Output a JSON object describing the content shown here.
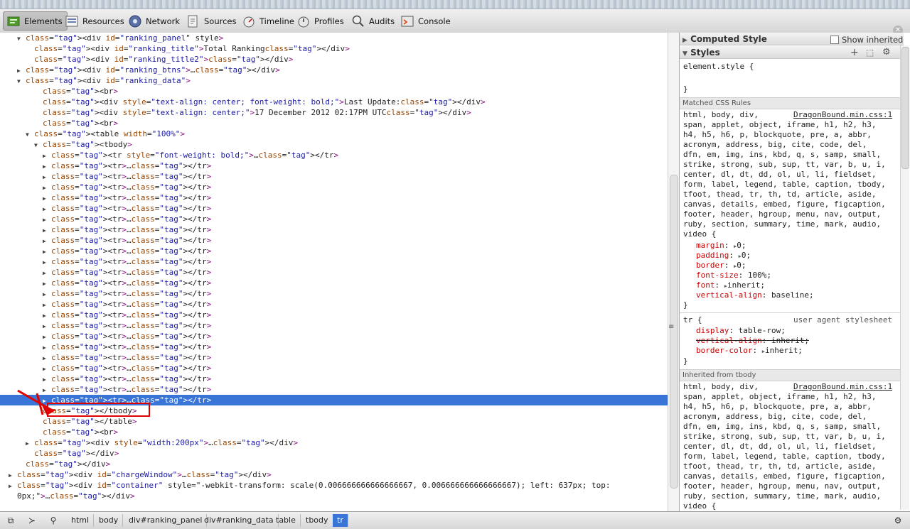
{
  "toolbar": {
    "tabs": [
      {
        "label": "Elements",
        "icon": "elements-icon"
      },
      {
        "label": "Resources",
        "icon": "resources-icon"
      },
      {
        "label": "Network",
        "icon": "network-icon"
      },
      {
        "label": "Sources",
        "icon": "sources-icon"
      },
      {
        "label": "Timeline",
        "icon": "timeline-icon"
      },
      {
        "label": "Profiles",
        "icon": "profiles-icon"
      },
      {
        "label": "Audits",
        "icon": "audits-icon"
      },
      {
        "label": "Console",
        "icon": "console-icon"
      }
    ],
    "active_tab": "Elements"
  },
  "dom_tree": {
    "lines": [
      {
        "tri": "▼",
        "text": "<div id=\"ranking_panel\" style>"
      },
      {
        "tri": "",
        "text": "<div id=\"ranking_title\">Total Ranking</div>"
      },
      {
        "tri": "",
        "text": "<div id=\"ranking_title2\"></div>"
      },
      {
        "tri": "▶",
        "text": "<div id=\"ranking_btns\">…</div>"
      },
      {
        "tri": "▼",
        "text": "<div id=\"ranking_data\">"
      },
      {
        "tri": "",
        "text": "<br>"
      },
      {
        "tri": "",
        "text": "<div style=\"text-align: center; font-weight: bold;\">Last Update:</div>"
      },
      {
        "tri": "",
        "text": "<div style=\"text-align: center;\">17 December 2012 02:17PM UTC</div>"
      },
      {
        "tri": "",
        "text": "<br>"
      },
      {
        "tri": "▼",
        "text": "<table width=\"100%\">"
      },
      {
        "tri": "▼",
        "text": "<tbody>"
      },
      {
        "tri": "▶",
        "text": "<tr style=\"font-weight: bold;\">…</tr>"
      },
      {
        "tri": "▶",
        "text": "<tr>…</tr>"
      },
      {
        "tri": "▶",
        "text": "<tr>…</tr>"
      },
      {
        "tri": "▶",
        "text": "<tr>…</tr>"
      },
      {
        "tri": "▶",
        "text": "<tr>…</tr>"
      },
      {
        "tri": "▶",
        "text": "<tr>…</tr>"
      },
      {
        "tri": "▶",
        "text": "<tr>…</tr>"
      },
      {
        "tri": "▶",
        "text": "<tr>…</tr>"
      },
      {
        "tri": "▶",
        "text": "<tr>…</tr>"
      },
      {
        "tri": "▶",
        "text": "<tr>…</tr>"
      },
      {
        "tri": "▶",
        "text": "<tr>…</tr>"
      },
      {
        "tri": "▶",
        "text": "<tr>…</tr>"
      },
      {
        "tri": "▶",
        "text": "<tr>…</tr>"
      },
      {
        "tri": "▶",
        "text": "<tr>…</tr>"
      },
      {
        "tri": "▶",
        "text": "<tr>…</tr>"
      },
      {
        "tri": "▶",
        "text": "<tr>…</tr>"
      },
      {
        "tri": "▶",
        "text": "<tr>…</tr>"
      },
      {
        "tri": "▶",
        "text": "<tr>…</tr>"
      },
      {
        "tri": "▶",
        "text": "<tr>…</tr>"
      },
      {
        "tri": "▶",
        "text": "<tr>…</tr>"
      },
      {
        "tri": "▶",
        "text": "<tr>…</tr>"
      },
      {
        "tri": "▶",
        "text": "<tr>…</tr>"
      },
      {
        "tri": "▶",
        "text": "<tr>…</tr>"
      },
      {
        "tri": "▶",
        "text": "<tr>…</tr>",
        "selected": true
      },
      {
        "tri": "",
        "text": "</tbody>"
      },
      {
        "tri": "",
        "text": "</table>"
      },
      {
        "tri": "",
        "text": "<br>"
      },
      {
        "tri": "▶",
        "text": "<div style=\"width:200px\">…</div>"
      },
      {
        "tri": "",
        "text": "</div>"
      },
      {
        "tri": "",
        "text": "</div>"
      },
      {
        "tri": "▶",
        "text": "<div id=\"chargeWindow\">…</div>"
      },
      {
        "tri": "▶",
        "text": "<div id=\"container\" style=\"-webkit-transform: scale(0.006666666666666667, 0.006666666666666667); left: 637px; top:"
      },
      {
        "tri": "",
        "text": "0px;\">…</div>"
      }
    ]
  },
  "sidebar": {
    "computed_style": {
      "title": "Computed Style",
      "show_inherited": "Show inherited"
    },
    "styles": {
      "title": "Styles"
    },
    "element_style": {
      "selector": "element.style {",
      "close": "}"
    },
    "matched_rules_header": "Matched CSS Rules",
    "rule1": {
      "source": "DragonBound.min.css:1",
      "selector": "html, body, div,\nspan, applet, object, iframe, h1, h2, h3,\nh4, h5, h6, p, blockquote, pre, a, abbr,\nacronym, address, big, cite, code, del,\ndfn, em, img, ins, kbd, q, s, samp, small,\nstrike, strong, sub, sup, tt, var, b, u, i,\ncenter, dl, dt, dd, ol, ul, li, fieldset,\nform, label, legend, table, caption, tbody,\ntfoot, thead, tr, th, td, article, aside,\ncanvas, details, embed, figure, figcaption,\nfooter, header, hgroup, menu, nav, output,\nruby, section, summary, time, mark, audio,\nvideo {",
      "props": [
        {
          "name": "margin",
          "arrow": true,
          "value": "0;"
        },
        {
          "name": "padding",
          "arrow": true,
          "value": "0;"
        },
        {
          "name": "border",
          "arrow": true,
          "value": "0;"
        },
        {
          "name": "font-size",
          "arrow": false,
          "value": "100%;"
        },
        {
          "name": "font",
          "arrow": true,
          "value": "inherit;"
        },
        {
          "name": "vertical-align",
          "arrow": false,
          "value": "baseline;"
        }
      ],
      "close": "}"
    },
    "rule2": {
      "source": "user agent stylesheet",
      "selector": "tr {",
      "props": [
        {
          "name": "display",
          "arrow": false,
          "value": "table-row;",
          "struck": false
        },
        {
          "name": "vertical-align",
          "arrow": false,
          "value": "inherit;",
          "struck": true
        },
        {
          "name": "border-color",
          "arrow": true,
          "value": "inherit;",
          "struck": false
        }
      ],
      "close": "}"
    },
    "inherited_header": "Inherited from tbody",
    "rule3": {
      "source": "DragonBound.min.css:1",
      "selector": "html, body, div,\nspan, applet, object, iframe, h1, h2, h3,\nh4, h5, h6, p, blockquote, pre, a, abbr,\nacronym, address, big, cite, code, del,\ndfn, em, img, ins, kbd, q, s, samp, small,\nstrike, strong, sub, sup, tt, var, b, u, i,\ncenter, dl, dt, dd, ol, ul, li, fieldset,\nform, label, legend, table, caption, tbody,\ntfoot, thead, tr, th, td, article, aside,\ncanvas, details, embed, figure, figcaption,\nfooter, header, hgroup, menu, nav, output,\nruby, section, summary, time, mark, audio,\nvideo {"
    }
  },
  "statusbar": {
    "breadcrumbs": [
      "html",
      "body",
      "div#ranking_panel",
      "div#ranking_data",
      "table",
      "tbody",
      "tr"
    ],
    "current": "tr"
  },
  "colors": {
    "selection": "#3875d7",
    "annotation": "#e10000",
    "tag": "#881280",
    "attr_name": "#994500",
    "attr_value": "#1a1aa6",
    "css_prop": "#c80000"
  }
}
